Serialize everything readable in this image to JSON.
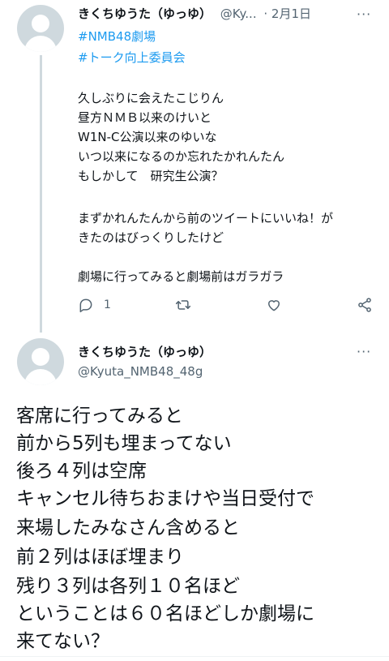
{
  "tweet1": {
    "name": "きくちゆうた（ゆっゆ）",
    "handle": "@Ky...",
    "date": "· 2月1日",
    "hashtags": [
      "#NMB48劇場",
      "#トーク向上委員会"
    ],
    "lines": [
      "久しぶりに会えたこじりん",
      "昼方ＮＭＢ以来のけいと",
      "W1N-C公演以来のゆいな",
      "いつ以来になるのか忘れたかれんたん",
      "もしかして　研究生公演？",
      "まずかれんたんから前のツイートにいいね！が",
      "きたのはびっくりしたけど",
      "劇場に行ってみると劇場前はガラガラ"
    ],
    "reply_count": "1"
  },
  "tweet2": {
    "name": "きくちゆうた（ゆっゆ）",
    "handle": "@Kyuta_NMB48_48g",
    "lines": [
      "客席に行ってみると",
      "前から5列も埋まってない",
      "後ろ４列は空席",
      "キャンセル待ちおまけや当日受付で",
      "来場したみなさん含めると",
      "前２列はほぼ埋まり",
      "残り３列は各列１０名ほど",
      "ということは６０名ほどしか劇場に",
      "来てない？"
    ]
  }
}
